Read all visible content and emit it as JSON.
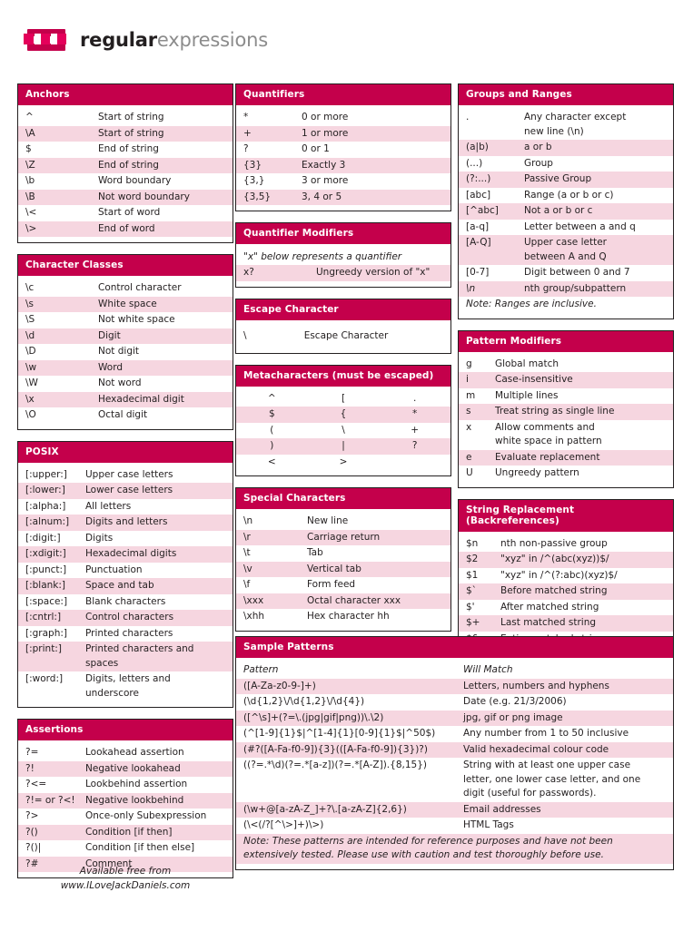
{
  "logo": {
    "word_bold": "regular",
    "word_light": "expressions"
  },
  "sections": {
    "anchors": {
      "title": "Anchors",
      "rows": [
        {
          "k": "^",
          "v": "Start of string"
        },
        {
          "k": "\\A",
          "v": "Start of string"
        },
        {
          "k": "$",
          "v": "End of string"
        },
        {
          "k": "\\Z",
          "v": "End of string"
        },
        {
          "k": "\\b",
          "v": "Word boundary"
        },
        {
          "k": "\\B",
          "v": "Not word boundary"
        },
        {
          "k": "\\<",
          "v": "Start of word"
        },
        {
          "k": "\\>",
          "v": "End of word"
        }
      ]
    },
    "character_classes": {
      "title": "Character Classes",
      "rows": [
        {
          "k": "\\c",
          "v": "Control character"
        },
        {
          "k": "\\s",
          "v": "White space"
        },
        {
          "k": "\\S",
          "v": "Not white space"
        },
        {
          "k": "\\d",
          "v": "Digit"
        },
        {
          "k": "\\D",
          "v": "Not digit"
        },
        {
          "k": "\\w",
          "v": "Word"
        },
        {
          "k": "\\W",
          "v": "Not word"
        },
        {
          "k": "\\x",
          "v": "Hexadecimal digit"
        },
        {
          "k": "\\O",
          "v": "Octal digit"
        }
      ]
    },
    "posix": {
      "title": "POSIX",
      "rows": [
        {
          "k": "[:upper:]",
          "v": "Upper case letters"
        },
        {
          "k": "[:lower:]",
          "v": "Lower case letters"
        },
        {
          "k": "[:alpha:]",
          "v": "All letters"
        },
        {
          "k": "[:alnum:]",
          "v": "Digits and letters"
        },
        {
          "k": "[:digit:]",
          "v": "Digits"
        },
        {
          "k": "[:xdigit:]",
          "v": "Hexadecimal digits"
        },
        {
          "k": "[:punct:]",
          "v": "Punctuation"
        },
        {
          "k": "[:blank:]",
          "v": "Space and tab"
        },
        {
          "k": "[:space:]",
          "v": "Blank characters"
        },
        {
          "k": "[:cntrl:]",
          "v": "Control characters"
        },
        {
          "k": "[:graph:]",
          "v": "Printed characters"
        },
        {
          "k": "[:print:]",
          "v": "Printed characters and",
          "v2": "spaces"
        },
        {
          "k": "[:word:]",
          "v": "Digits, letters and",
          "v2": "underscore"
        }
      ]
    },
    "assertions": {
      "title": "Assertions",
      "rows": [
        {
          "k": "?=",
          "v": "Lookahead assertion"
        },
        {
          "k": "?!",
          "v": "Negative lookahead"
        },
        {
          "k": "?<=",
          "v": "Lookbehind assertion"
        },
        {
          "k": "?!= or ?<!",
          "v": "Negative lookbehind"
        },
        {
          "k": "?>",
          "v": "Once-only Subexpression"
        },
        {
          "k": "?()",
          "v": "Condition [if then]"
        },
        {
          "k": "?()|",
          "v": "Condition [if then else]"
        },
        {
          "k": "?#",
          "v": "Comment"
        }
      ]
    },
    "quantifiers": {
      "title": "Quantifiers",
      "rows": [
        {
          "k": "*",
          "v": "0 or more"
        },
        {
          "k": "+",
          "v": "1 or more"
        },
        {
          "k": "?",
          "v": "0 or 1"
        },
        {
          "k": "{3}",
          "v": "Exactly 3"
        },
        {
          "k": "{3,}",
          "v": "3 or more"
        },
        {
          "k": "{3,5}",
          "v": "3, 4 or 5"
        }
      ]
    },
    "quantifier_modifiers": {
      "title": "Quantifier Modifiers",
      "intro": "\"x\" below represents a quantifier",
      "rows": [
        {
          "k": "x?",
          "v": "Ungreedy version of \"x\""
        }
      ]
    },
    "escape_character": {
      "title": "Escape Character",
      "key": "\\",
      "value": "Escape Character"
    },
    "metacharacters": {
      "title": "Metacharacters (must be escaped)",
      "grid": [
        [
          "^",
          "[",
          "."
        ],
        [
          "$",
          "{",
          "*"
        ],
        [
          "(",
          "\\",
          "+"
        ],
        [
          ")",
          "|",
          "?"
        ],
        [
          "<",
          ">",
          ""
        ]
      ]
    },
    "special_characters": {
      "title": "Special Characters",
      "rows": [
        {
          "k": "\\n",
          "v": "New line"
        },
        {
          "k": "\\r",
          "v": "Carriage return"
        },
        {
          "k": "\\t",
          "v": "Tab"
        },
        {
          "k": "\\v",
          "v": "Vertical tab"
        },
        {
          "k": "\\f",
          "v": "Form feed"
        },
        {
          "k": "\\xxx",
          "v": "Octal character xxx"
        },
        {
          "k": "\\xhh",
          "v": "Hex character hh"
        }
      ]
    },
    "groups_and_ranges": {
      "title": "Groups and Ranges",
      "rows": [
        {
          "k": ".",
          "v": "Any character except",
          "v2": "new line (\\n)"
        },
        {
          "k": "(a|b)",
          "v": "a or b"
        },
        {
          "k": "(...)",
          "v": "Group"
        },
        {
          "k": "(?:...)",
          "v": "Passive Group"
        },
        {
          "k": "[abc]",
          "v": "Range (a or b or c)"
        },
        {
          "k": "[^abc]",
          "v": "Not a or b or c"
        },
        {
          "k": "[a-q]",
          "v": "Letter between a and q"
        },
        {
          "k": "[A-Q]",
          "v": "Upper case letter",
          "v2": "between A and Q"
        },
        {
          "k": "[0-7]",
          "v": "Digit between 0 and 7"
        },
        {
          "k": "\\n",
          "v": "nth group/subpattern",
          "k_italic": true
        }
      ],
      "note": "Note: Ranges are inclusive."
    },
    "pattern_modifiers": {
      "title": "Pattern Modifiers",
      "rows": [
        {
          "k": "g",
          "v": "Global match"
        },
        {
          "k": "i",
          "v": "Case-insensitive"
        },
        {
          "k": "m",
          "v": "Multiple lines"
        },
        {
          "k": "s",
          "v": "Treat string as single line"
        },
        {
          "k": "x",
          "v": "Allow comments and",
          "v2": "white space in pattern"
        },
        {
          "k": "e",
          "v": "Evaluate replacement"
        },
        {
          "k": "U",
          "v": "Ungreedy pattern"
        }
      ]
    },
    "string_replacement": {
      "title": "String Replacement (Backreferences)",
      "rows": [
        {
          "k": "$n",
          "v": "nth non-passive group"
        },
        {
          "k": "$2",
          "v": "\"xyz\" in /^(abc(xyz))$/"
        },
        {
          "k": "$1",
          "v": "\"xyz\" in /^(?:abc)(xyz)$/"
        },
        {
          "k": "$`",
          "v": "Before matched string"
        },
        {
          "k": "$'",
          "v": "After matched string"
        },
        {
          "k": "$+",
          "v": "Last matched string"
        },
        {
          "k": "$&",
          "v": "Entire matched string"
        }
      ]
    },
    "sample_patterns": {
      "title": "Sample Patterns",
      "header": {
        "pattern": "Pattern",
        "match": "Will Match"
      },
      "rows": [
        {
          "p": "([A-Za-z0-9-]+)",
          "m": "Letters, numbers and hyphens"
        },
        {
          "p": "(\\d{1,2}\\/\\d{1,2}\\/\\d{4})",
          "m": "Date (e.g. 21/3/2006)"
        },
        {
          "p": "([^\\s]+(?=\\.(jpg|gif|png))\\.\\2)",
          "m": "jpg, gif or png image"
        },
        {
          "p": "(^[1-9]{1}$|^[1-4]{1}[0-9]{1}$|^50$)",
          "m": "Any number from 1 to 50 inclusive"
        },
        {
          "p": "(#?([A-Fa-f0-9]){3}(([A-Fa-f0-9]){3})?)",
          "m": "Valid hexadecimal colour code"
        },
        {
          "p": "((?=.*\\d)(?=.*[a-z])(?=.*[A-Z]).{8,15})",
          "m": "String with at least one upper case",
          "m2": "letter, one lower case letter, and one",
          "m3": "digit (useful for passwords)."
        },
        {
          "p": "(\\w+@[a-zA-Z_]+?\\.[a-zA-Z]{2,6})",
          "m": "Email addresses"
        },
        {
          "p": "(\\<(/?[^\\>]+)\\>)",
          "m": "HTML Tags"
        }
      ],
      "note_line1": "Note: These patterns are intended for reference purposes and have not been",
      "note_line2": "extensively tested. Please use with caution and test thoroughly before use."
    }
  },
  "footer": {
    "line1": "Available free from",
    "line2": "www.ILoveJackDaniels.com"
  },
  "colors": {
    "header": "#c4004b",
    "stripe": "#f6d6e0",
    "text": "#231f20",
    "logo_grey": "#8c8c8c"
  }
}
